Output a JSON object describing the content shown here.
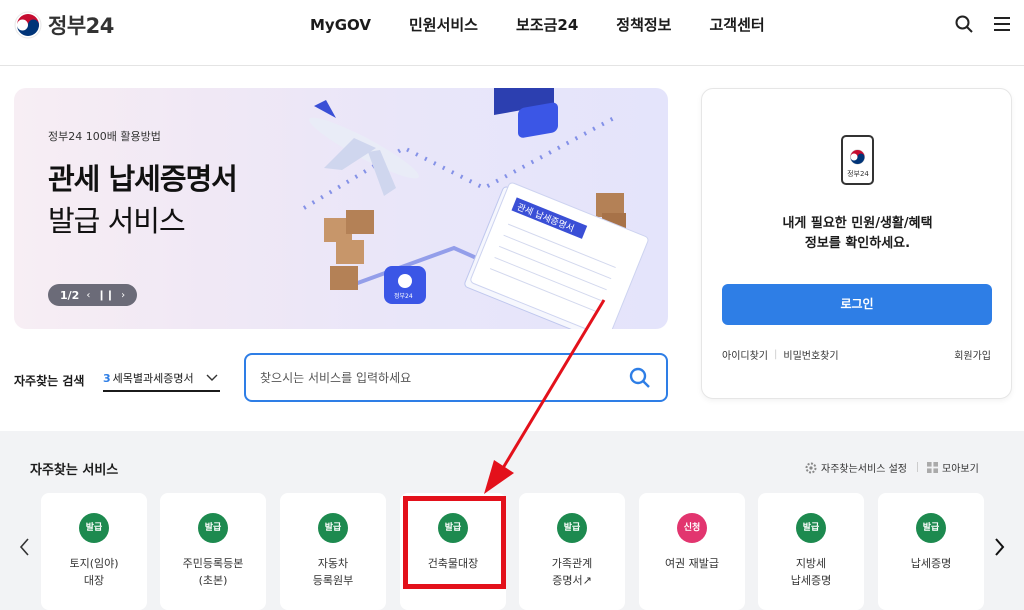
{
  "header": {
    "logo_text": "정부24",
    "nav": [
      "MyGOV",
      "민원서비스",
      "보조금24",
      "정책정보",
      "고객센터"
    ]
  },
  "banner": {
    "subtitle": "정부24 100배 활용방법",
    "title_line1": "관세 납세증명서",
    "title_line2": "발급 서비스",
    "pager_current": "1/2",
    "document_label": "관세 납세증명서",
    "badge_label": "정부24"
  },
  "login": {
    "app_label": "정부24",
    "message_line1": "내게 필요한 민원/생활/혜택",
    "message_line2": "정보를 확인하세요.",
    "button_label": "로그인",
    "find_id": "아이디찾기",
    "find_pw": "비밀번호찾기",
    "join": "회원가입"
  },
  "search": {
    "label": "자주찾는 검색",
    "select_rank": "3",
    "select_value": "세목별과세증명서",
    "placeholder": "찾으시는 서비스를 입력하세요"
  },
  "services": {
    "title": "자주찾는 서비스",
    "settings_label": "자주찾는서비스 설정",
    "view_all_label": "모아보기",
    "items": [
      {
        "badge": "발급",
        "label": "토지(임야)\n대장",
        "color": "#1d8a4f"
      },
      {
        "badge": "발급",
        "label": "주민등록등본\n(초본)",
        "color": "#1d8a4f"
      },
      {
        "badge": "발급",
        "label": "자동차\n등록원부",
        "color": "#1d8a4f"
      },
      {
        "badge": "발급",
        "label": "건축물대장",
        "color": "#1d8a4f"
      },
      {
        "badge": "발급",
        "label": "가족관계\n증명서↗",
        "color": "#1d8a4f"
      },
      {
        "badge": "신청",
        "label": "여권 재발급",
        "color": "#e2356f"
      },
      {
        "badge": "발급",
        "label": "지방세\n납세증명",
        "color": "#1d8a4f"
      },
      {
        "badge": "발급",
        "label": "납세증명",
        "color": "#1d8a4f"
      }
    ]
  },
  "colors": {
    "accent": "#2e7ee6",
    "issue_badge": "#1d8a4f",
    "apply_badge": "#e2356f",
    "highlight": "#e3111b"
  }
}
